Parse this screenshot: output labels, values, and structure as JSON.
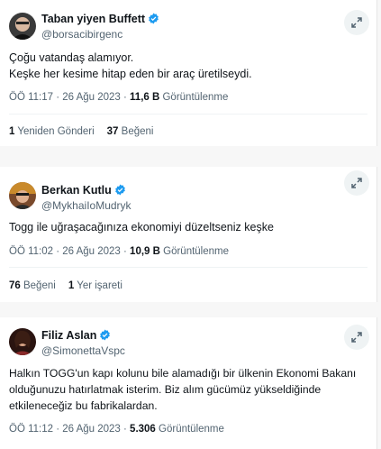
{
  "tweets": [
    {
      "name": "Taban yiyen Buffett",
      "handle": "@borsacibirgenc",
      "lines": [
        "Çoğu vatandaş alamıyor.",
        "Keşke her kesime hitap eden bir araç üretilseydi."
      ],
      "time": "ÖÖ 11:17 · 26 Ağu 2023 · ",
      "views": "11,6 B",
      "views_label": " Görüntülenme",
      "stat1_value": "1",
      "stat1_label": " Yeniden Gönderi",
      "stat2_value": "37",
      "stat2_label": " Beğeni"
    },
    {
      "name": "Berkan Kutlu",
      "handle": "@MykhaiIoMudryk",
      "lines": [
        "Togg ile uğraşacağınıza ekonomiyi düzeltseniz keşke"
      ],
      "time": "ÖÖ 11:02 · 26 Ağu 2023 · ",
      "views": "10,9 B",
      "views_label": " Görüntülenme",
      "stat1_value": "76",
      "stat1_label": " Beğeni",
      "stat2_value": "1",
      "stat2_label": " Yer işareti"
    },
    {
      "name": "Filiz Aslan",
      "handle": "@SimonettaVspc",
      "lines": [
        "Halkın TOGG'un kapı kolunu bile alamadığı bir ülkenin Ekonomi Bakanı",
        "olduğunuzu hatırlatmak isterim. Biz alım gücümüz yükseldiğinde",
        "etkileneceğiz bu fabrikalardan."
      ],
      "time": "ÖÖ 11:12 · 26 Ağu 2023 · ",
      "views": "5.306",
      "views_label": " Görüntülenme"
    }
  ],
  "colors": {
    "verified": "#1d9bf0",
    "secondary_text": "#536471",
    "primary_text": "#0f1419"
  },
  "icons": {
    "expand": "expand-arrows-icon",
    "verified": "verified-badge-icon"
  }
}
